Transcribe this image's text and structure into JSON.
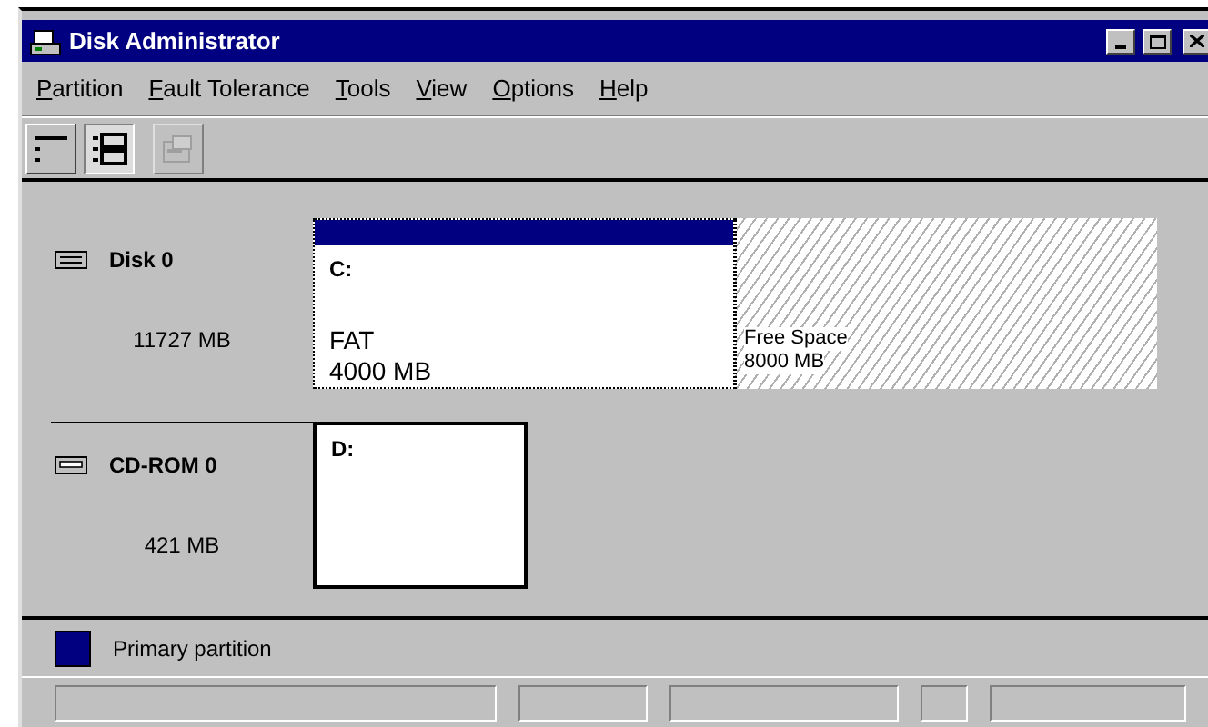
{
  "window": {
    "title": "Disk Administrator"
  },
  "menu": [
    "Partition",
    "Fault Tolerance",
    "Tools",
    "View",
    "Options",
    "Help"
  ],
  "toolbar": [
    {
      "kind": "volumes",
      "selected": false,
      "disabled": false
    },
    {
      "kind": "disks",
      "selected": true,
      "disabled": false
    },
    {
      "kind": "properties",
      "selected": false,
      "disabled": true
    }
  ],
  "disks": [
    {
      "kind": "disk",
      "name": "Disk 0",
      "size": "11727 MB",
      "partitions": [
        {
          "kind": "primary",
          "letter": "C:",
          "fs": "FAT",
          "size": "4000 MB",
          "selected": true
        },
        {
          "kind": "free",
          "label": "Free Space",
          "size": "8000 MB",
          "selected": false
        }
      ]
    },
    {
      "kind": "cdrom",
      "name": "CD-ROM 0",
      "size": "421 MB",
      "partitions": [
        {
          "kind": "primary",
          "letter": "D:",
          "selected": false
        }
      ]
    }
  ],
  "legend": [
    {
      "label": "Primary partition",
      "color": "#000080"
    }
  ]
}
